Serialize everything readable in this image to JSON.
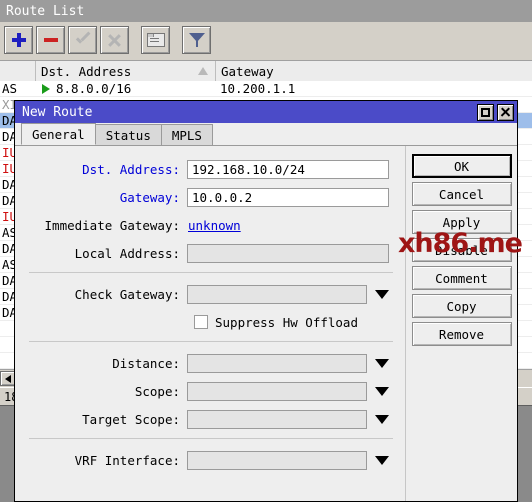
{
  "route_list": {
    "title": "Route List",
    "toolbar": [
      {
        "name": "add-button",
        "icon": "plus-icon",
        "enabled": true
      },
      {
        "name": "remove-button",
        "icon": "minus-icon",
        "enabled": true
      },
      {
        "name": "enable-button",
        "icon": "check-icon",
        "enabled": false
      },
      {
        "name": "disable-button",
        "icon": "cross-icon",
        "enabled": false
      },
      {
        "name": "comment-button",
        "icon": "comment-icon",
        "enabled": true
      },
      {
        "name": "filter-button",
        "icon": "funnel-icon",
        "enabled": true
      }
    ],
    "columns": {
      "flags": "",
      "dst_address": "Dst. Address",
      "gateway": "Gateway",
      "sort_indicator": "ascending"
    },
    "rows": [
      {
        "flags": "AS",
        "flag_color": "black",
        "dst": "8.8.0.0/16",
        "gateway": "10.200.1.1",
        "active": true,
        "selected": false
      },
      {
        "flags": "XI",
        "flag_color": "gray",
        "dst": "",
        "gateway": "",
        "active": false,
        "selected": false
      },
      {
        "flags": "DA",
        "flag_color": "black",
        "dst": "",
        "gateway": "",
        "active": true,
        "selected": true
      },
      {
        "flags": "DA",
        "flag_color": "black",
        "dst": "",
        "gateway": "",
        "active": true,
        "selected": false
      },
      {
        "flags": "IU",
        "flag_color": "red",
        "dst": "",
        "gateway": "",
        "active": false,
        "selected": false
      },
      {
        "flags": "IU",
        "flag_color": "red",
        "dst": "",
        "gateway": "",
        "active": false,
        "selected": false
      },
      {
        "flags": "DA",
        "flag_color": "black",
        "dst": "",
        "gateway": "",
        "active": true,
        "selected": false
      },
      {
        "flags": "DA",
        "flag_color": "black",
        "dst": "",
        "gateway": "",
        "active": true,
        "selected": false
      },
      {
        "flags": "IU",
        "flag_color": "red",
        "dst": "",
        "gateway": "",
        "active": false,
        "selected": false
      },
      {
        "flags": "AS",
        "flag_color": "black",
        "dst": "",
        "gateway": "",
        "active": true,
        "selected": false
      },
      {
        "flags": "DA",
        "flag_color": "black",
        "dst": "",
        "gateway": "",
        "active": true,
        "selected": false
      },
      {
        "flags": "AS",
        "flag_color": "black",
        "dst": "",
        "gateway": "",
        "active": true,
        "selected": false
      },
      {
        "flags": "DA",
        "flag_color": "black",
        "dst": "",
        "gateway": "",
        "active": true,
        "selected": false
      },
      {
        "flags": "DA",
        "flag_color": "black",
        "dst": "",
        "gateway": "",
        "active": true,
        "selected": false
      },
      {
        "flags": "DA",
        "flag_color": "black",
        "dst": "",
        "gateway": "",
        "active": true,
        "selected": false
      },
      {
        "flags": "",
        "flag_color": "black",
        "dst": "",
        "gateway": "",
        "active": false,
        "selected": false
      },
      {
        "flags": "",
        "flag_color": "black",
        "dst": "",
        "gateway": "",
        "active": false,
        "selected": false
      },
      {
        "flags": "",
        "flag_color": "black",
        "dst": "",
        "gateway": "",
        "active": false,
        "selected": false
      }
    ],
    "status_count": "18"
  },
  "dialog": {
    "title": "New Route",
    "titlebar_buttons": {
      "maximize": "maximize-icon",
      "close": "close-icon"
    },
    "tabs": [
      {
        "label": "General",
        "active": true
      },
      {
        "label": "Status",
        "active": false
      },
      {
        "label": "MPLS",
        "active": false
      }
    ],
    "fields": {
      "dst_address": {
        "label": "Dst. Address:",
        "value": "192.168.10.0/24"
      },
      "gateway": {
        "label": "Gateway:",
        "value": "10.0.0.2"
      },
      "immediate_gateway": {
        "label": "Immediate Gateway:",
        "value": "unknown"
      },
      "local_address": {
        "label": "Local Address:",
        "value": ""
      },
      "check_gateway": {
        "label": "Check Gateway:",
        "value": ""
      },
      "suppress_hw_offload": {
        "label": "Suppress Hw Offload",
        "checked": false
      },
      "distance": {
        "label": "Distance:",
        "value": ""
      },
      "scope": {
        "label": "Scope:",
        "value": ""
      },
      "target_scope": {
        "label": "Target Scope:",
        "value": ""
      },
      "vrf_interface": {
        "label": "VRF Interface:",
        "value": ""
      }
    },
    "buttons": [
      {
        "label": "OK",
        "default": true
      },
      {
        "label": "Cancel",
        "default": false
      },
      {
        "label": "Apply",
        "default": false
      },
      {
        "label": "Disable",
        "default": false
      },
      {
        "label": "Comment",
        "default": false
      },
      {
        "label": "Copy",
        "default": false
      },
      {
        "label": "Remove",
        "default": false
      }
    ]
  },
  "watermark": {
    "text": "xh86.me",
    "color": "#9e1515"
  }
}
